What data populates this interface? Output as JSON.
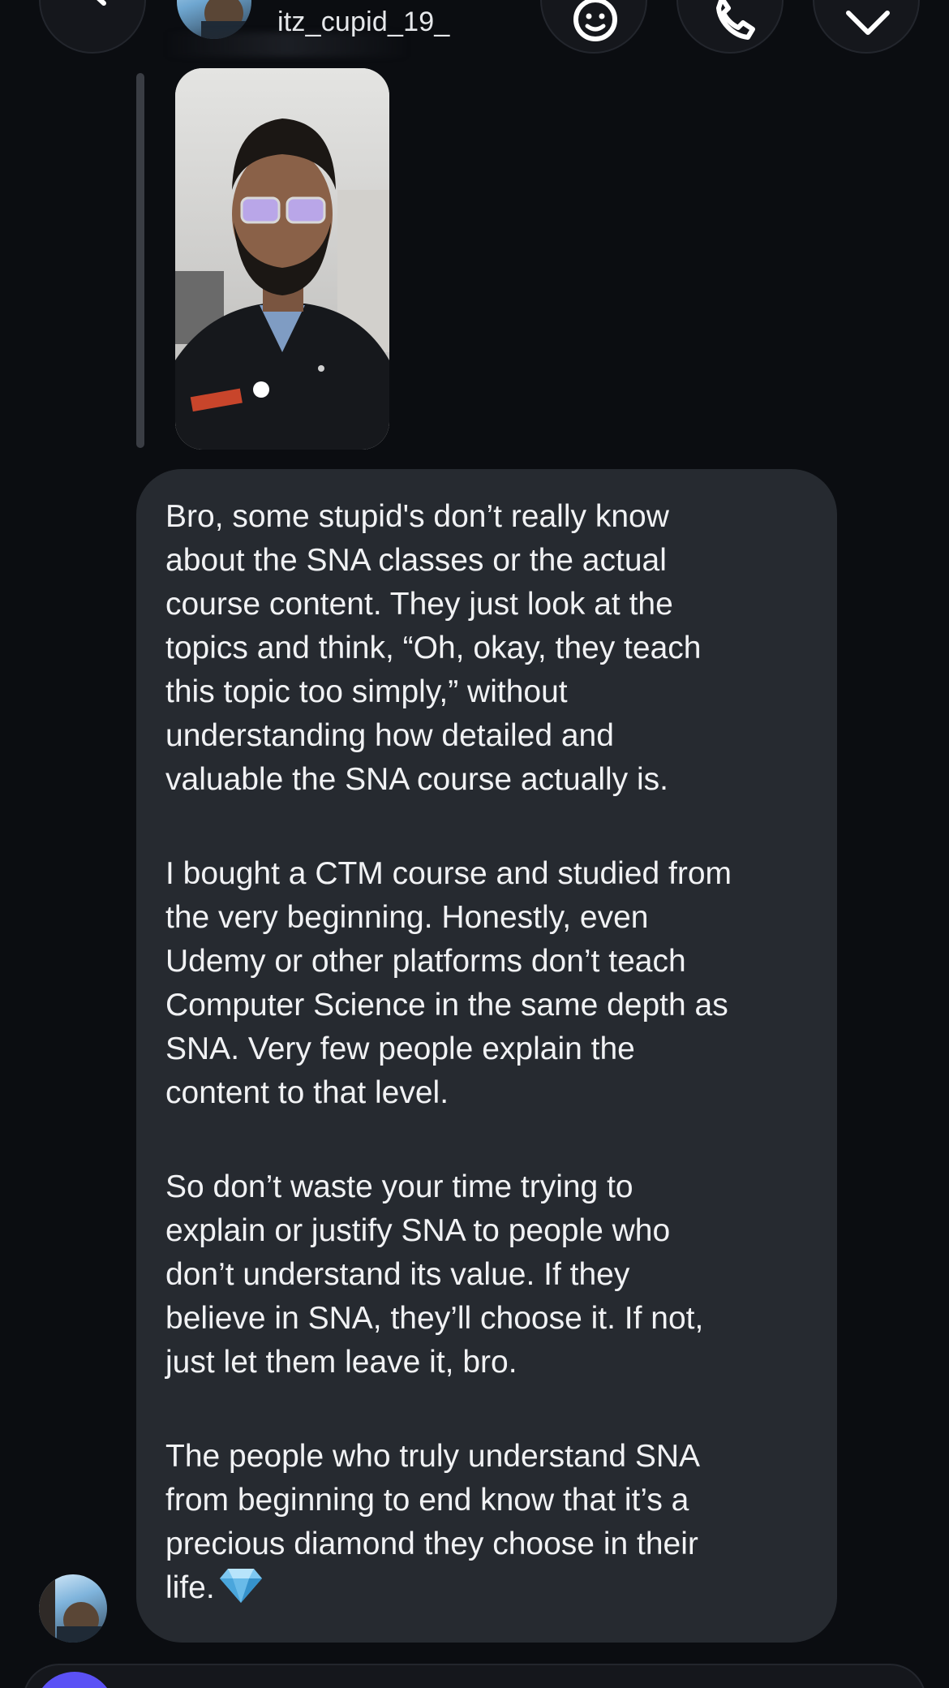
{
  "header": {
    "username": "itz_cupid_19_",
    "icons": [
      "back-icon",
      "sticker-icon",
      "phone-icon",
      "tag-icon"
    ]
  },
  "reply": {
    "media": "video-thumbnail"
  },
  "message": {
    "paragraphs": [
      "Bro, some stupid's don’t really know\nabout the SNA classes or the actual\ncourse content. They just look at the\ntopics and think, “Oh, okay, they teach\nthis topic too simply,” without\nunderstanding how detailed and\nvaluable the SNA course actually is.",
      "I bought a CTM course and studied from\nthe very beginning. Honestly, even\nUdemy or other platforms don’t teach\nComputer Science in the same depth as\nSNA. Very few people explain the\ncontent to that level.",
      "So don’t waste your time trying to\nexplain or justify SNA to people who\ndon’t understand its value. If they\nbelieve in SNA, they’ll choose it. If not,\njust let them leave it, bro.",
      "The people who truly understand SNA\nfrom beginning to end know that it’s a\nprecious diamond they choose in their\nlife."
    ],
    "emoji": "gem-icon"
  },
  "composer": {
    "placeholder": "",
    "icons": [
      "camera-icon"
    ]
  },
  "colors": {
    "background": "#0b0d11",
    "bubble": "#262a30",
    "accent": "#5b51f5",
    "text": "#f1f2f4"
  }
}
